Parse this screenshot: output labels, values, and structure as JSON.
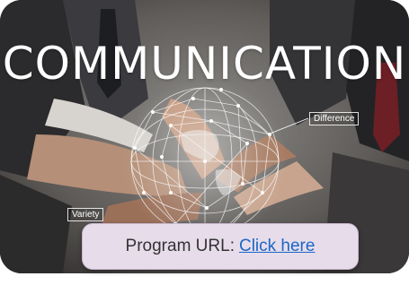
{
  "banner": {
    "headline": "COMMUNICATION",
    "tags": {
      "difference": "Difference",
      "variety": "Variety"
    }
  },
  "callout": {
    "prefix": "Program URL:",
    "link_text": "Click here"
  },
  "colors": {
    "callout_background": "#e7dcea",
    "link": "#1a67c8",
    "headline": "#ffffff"
  }
}
